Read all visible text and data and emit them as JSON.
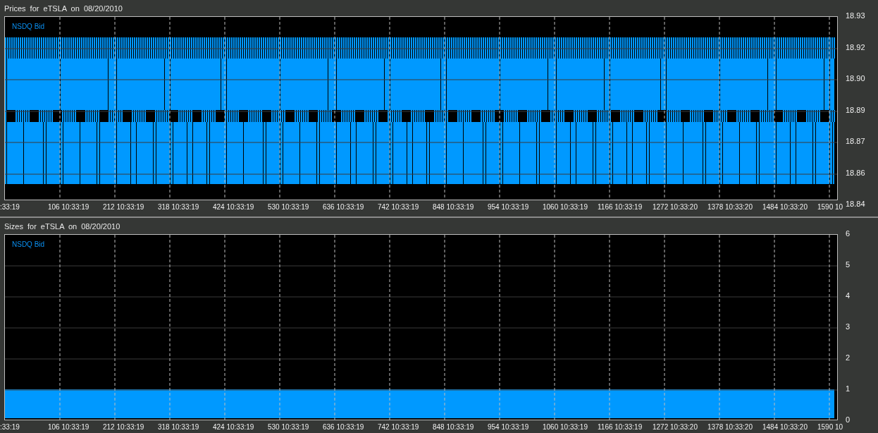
{
  "panels": [
    {
      "kind": "price",
      "title": "Prices for eTSLA on 08/20/2010",
      "legend": "NSDQ Bid",
      "yticks": [
        "18.93",
        "18.92",
        "18.90",
        "18.89",
        "18.87",
        "18.86",
        "18.84"
      ],
      "xticks": [
        ":33:19",
        "106 10:33:19",
        "212 10:33:19",
        "318 10:33:19",
        "424 10:33:19",
        "530 10:33:19",
        "636 10:33:19",
        "742 10:33:19",
        "848 10:33:19",
        "954 10:33:19",
        "1060 10:33:19",
        "1166 10:33:19",
        "1272 10:33:20",
        "1378 10:33:20",
        "1484 10:33:20",
        "1590 10"
      ]
    },
    {
      "kind": "size",
      "title": "Sizes for eTSLA on 08/20/2010",
      "legend": "NSDQ Bid",
      "yticks": [
        "6",
        "5",
        "4",
        "3",
        "2",
        "1",
        "0"
      ],
      "xticks": [
        ":33:19",
        "106 10:33:19",
        "212 10:33:19",
        "318 10:33:19",
        "424 10:33:19",
        "530 10:33:19",
        "636 10:33:19",
        "742 10:33:19",
        "848 10:33:19",
        "954 10:33:19",
        "1060 10:33:19",
        "1166 10:33:19",
        "1272 10:33:20",
        "1378 10:33:20",
        "1484 10:33:20",
        "1590 10"
      ]
    }
  ]
}
